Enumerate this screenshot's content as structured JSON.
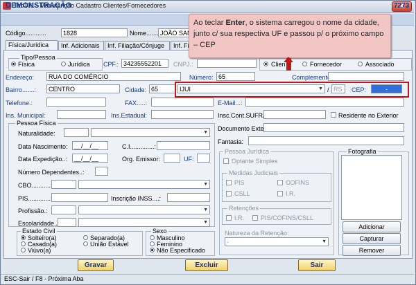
{
  "window": {
    "title": "Tab101 - Manutenção Cadastro Clientes/Fornecedores",
    "close": "X"
  },
  "header": {
    "title": "DEMONSTRAÇÃO",
    "number": "7273"
  },
  "top": {
    "codigo_label": "Código............",
    "codigo_value": "1828",
    "nome_label": "Nome.......",
    "nome_value": "JOÃO SANT"
  },
  "tabs": [
    "Física/Jurídica",
    "Inf. Adicionais",
    "Inf. Filiação/Cônjuge",
    "Inf. Fi"
  ],
  "tipo_pessoa": {
    "title": "Tipo/Pessoa",
    "fisica": "Física",
    "juridica": "Jurídica"
  },
  "cpf": {
    "label": "CPF.:",
    "value": "34235552201"
  },
  "cnpj": {
    "label": "CNPJ.:"
  },
  "tipo_cadastro": {
    "cliente": "Clien",
    "fornecedor": "Fornecedor",
    "associado": "Associado"
  },
  "endereco": {
    "label": "Endereço:",
    "value": "RUA DO COMÉRCIO"
  },
  "numero": {
    "label": "Número:",
    "value": "65"
  },
  "complemento": {
    "label": "Complemento:"
  },
  "bairro": {
    "label": "Bairro.......:",
    "value": "CENTRO"
  },
  "cidade": {
    "label": "Cidade:",
    "code": "65",
    "name": "IJUI",
    "slash": "/",
    "uf": "RS"
  },
  "cep": {
    "label": "CEP:",
    "value": "-"
  },
  "telefone": {
    "label": "Telefone.:"
  },
  "fax": {
    "label": "FAX.....:"
  },
  "email": {
    "label": "E-Mail...:"
  },
  "ins_municipal": {
    "label": "Ins. Municipal:"
  },
  "ins_estadual": {
    "label": "Ins.Estadual:"
  },
  "suframa": {
    "label": "Insc.Cont.SUFRAMA:"
  },
  "residente": {
    "label": "Residente no Exterior"
  },
  "documento_exterior": {
    "label": "Documento Exterior.:"
  },
  "fantasia": {
    "label": "Fantasia:"
  },
  "pessoa_fisica": {
    "title": "Pessoa Física",
    "naturalidade": "Naturalidade:",
    "data_nascimento": "Data Nascimento:",
    "date_mask": "__/__/__",
    "ci": "C.I..............:",
    "data_expedicao": "Data Expedição..:",
    "orgao_emissor": "Org. Emissor:",
    "uf": "UF:",
    "numero_dependentes": "Número Dependentes..:",
    "cbo": "CBO...........:",
    "pis": "PIS.............:",
    "inscricao_inss": "Inscrição INSS....:",
    "profissao": "Profissão.:",
    "escolaridade": "Escolaridade......:"
  },
  "estado_civil": {
    "title": "Estado Civil",
    "options": [
      "Solteiro(a)",
      "Casado(a)",
      "Viúvo(a)",
      "Separado(a)",
      "União Estável"
    ]
  },
  "sexo": {
    "title": "Sexo",
    "options": [
      "Masculino",
      "Feminino",
      "Não Especificado"
    ]
  },
  "pessoa_juridica": {
    "title": "Pessoa Jurídica",
    "optante": "Optante Simples",
    "medidas_title": "Medidas Judiciais",
    "medidas": [
      "PIS",
      "COFINS",
      "CSLL",
      "I.R."
    ],
    "retencoes_title": "Retenções",
    "retencoes": [
      "I.R.",
      "PIS/COFINS/CSLL"
    ],
    "natureza_label": "Natureza da Retenção:",
    "natureza_value": "-"
  },
  "fotografia": {
    "title": "Fotografia",
    "adicionar": "Adicionar",
    "capturar": "Capturar",
    "remover": "Remover"
  },
  "actions": {
    "gravar": "Gravar",
    "excluir": "Excluir",
    "sair": "Sair"
  },
  "status": {
    "text": "ESC-Sair / F8 - Próxima Aba"
  },
  "callout": {
    "part1": "Ao teclar ",
    "bold": "Enter",
    "part2": ", o sistema carregou o nome da cidade, junto c/ sua respectiva UF e passou p/ o próximo campo – CEP"
  }
}
